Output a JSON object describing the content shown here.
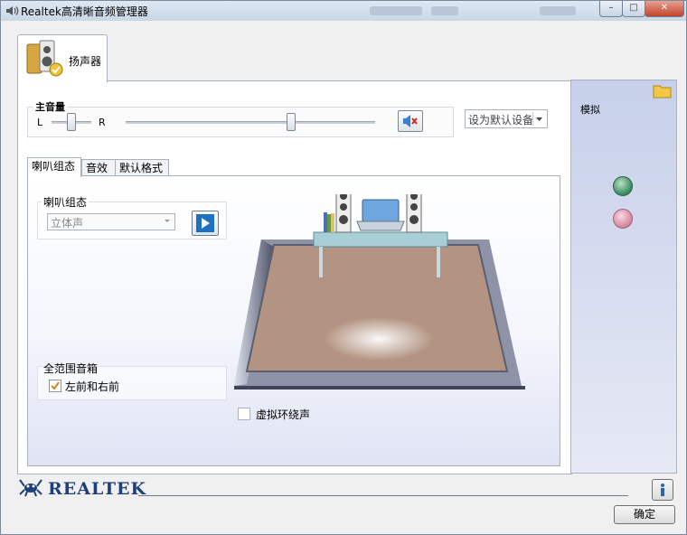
{
  "window": {
    "title": "Realtek高清晰音频管理器",
    "controls": {
      "minimize": "–",
      "maximize": "□",
      "close": "✕"
    }
  },
  "device_tab": {
    "label": "扬声器",
    "icon": "speaker-device-icon"
  },
  "volume": {
    "title": "主音量",
    "left_label": "L",
    "right_label": "R",
    "balance_level": 0.5,
    "master_level": 0.66,
    "mute_icon": "speaker-mute-icon"
  },
  "default_device": {
    "value": "设为默认设备"
  },
  "tabs": [
    {
      "label": "喇叭组态",
      "active": true
    },
    {
      "label": "音效",
      "active": false
    },
    {
      "label": "默认格式",
      "active": false
    }
  ],
  "speaker_config": {
    "group_title": "喇叭组态",
    "select_value": "立体声",
    "play_icon": "play-icon"
  },
  "full_range": {
    "group_title": "全范围音箱",
    "checkbox_label": "左前和右前",
    "checked": true
  },
  "virtual_surround": {
    "label": "虚拟环绕声",
    "checked": false
  },
  "analog_panel": {
    "title": "模拟",
    "jacks": [
      {
        "color": "#3f8f62"
      },
      {
        "color": "#d889a1"
      }
    ]
  },
  "footer": {
    "brand": "REALTEK",
    "info_icon": "info-icon",
    "ok_label": "确定"
  },
  "colors": {
    "carpet": "#b39482",
    "accent_blue": "#1d70c2",
    "panel_lavender": "#d2d8ef"
  }
}
